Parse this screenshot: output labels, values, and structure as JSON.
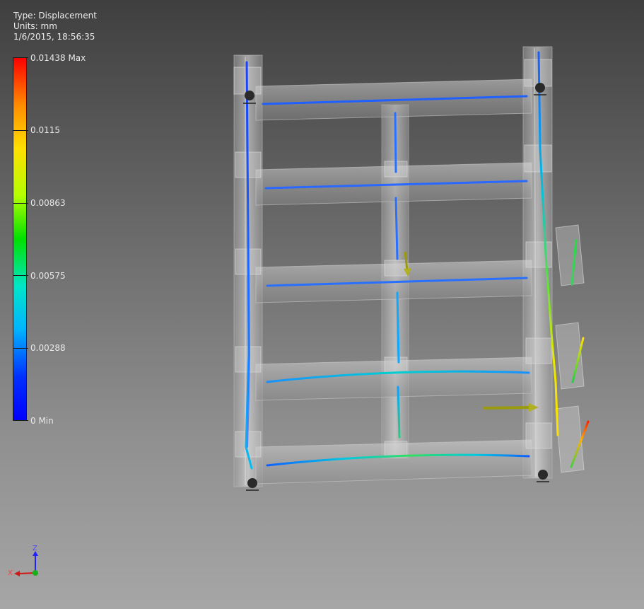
{
  "result_info": {
    "type": "Type: Displacement",
    "units": "Units: mm",
    "timestamp": "1/6/2015, 18:56:35"
  },
  "legend": {
    "ticks": [
      {
        "label": "0.01438 Max",
        "fraction": 1.0
      },
      {
        "label": "0.0115",
        "fraction": 0.8
      },
      {
        "label": "0.00863",
        "fraction": 0.6
      },
      {
        "label": "0.00575",
        "fraction": 0.4
      },
      {
        "label": "0.00288",
        "fraction": 0.2
      },
      {
        "label": "0 Min",
        "fraction": 0.0
      }
    ],
    "gradient_colors": [
      "#ff0000",
      "#ff8c00",
      "#ffe000",
      "#b4ff00",
      "#00e000",
      "#00e6c8",
      "#00b4ff",
      "#0030ff",
      "#0000ff"
    ]
  },
  "triad": {
    "z_label": "Z",
    "x_label": "X",
    "x_color": "#d01818",
    "y_color": "#18b018",
    "z_color": "#2020ff"
  },
  "colors": {
    "frame_fill": "#c8c8c8",
    "arrow": "#9a9a10",
    "constraint": "#2a2a2a"
  }
}
